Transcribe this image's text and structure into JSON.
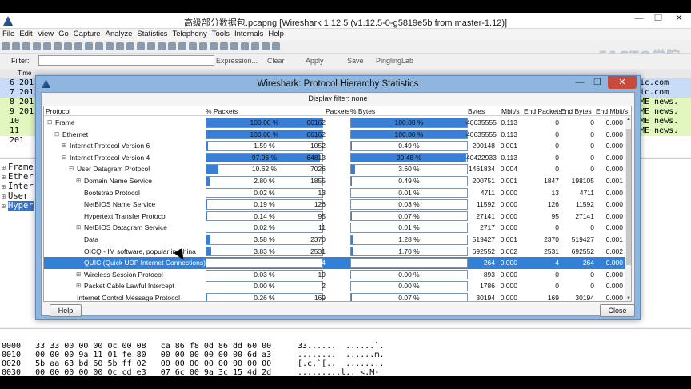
{
  "window": {
    "title": "高级部分数据包.pcapng   [Wireshark 1.12.5  (v1.12.5-0-g5819e5b from master-1.12)]",
    "minimize": "—",
    "maximize": "❐",
    "close": "✕"
  },
  "menu": [
    "File",
    "Edit",
    "View",
    "Go",
    "Capture",
    "Analyze",
    "Statistics",
    "Telephony",
    "Tools",
    "Internals",
    "Help"
  ],
  "filterbar": {
    "label": "Filter:",
    "value": "",
    "buttons": [
      "Expression...",
      "Clear",
      "Apply",
      "Save",
      "PinglingLab"
    ]
  },
  "watermark": "51CTO学院",
  "packet_list": {
    "header": "Time",
    "rows": [
      "6 201",
      "7 201",
      "8 201",
      "9 201",
      "10 201",
      "11 201"
    ],
    "right_rows": [
      "ic.com",
      "ic.com",
      "ME news.",
      "ME news.",
      "ME news.",
      "ME news."
    ]
  },
  "detail_tree": [
    {
      "label": "Frame",
      "selected": false
    },
    {
      "label": "Ether",
      "selected": false
    },
    {
      "label": "Inter",
      "selected": false
    },
    {
      "label": "User ",
      "selected": false
    },
    {
      "label": "Hyper",
      "selected": true
    }
  ],
  "hex_dump": [
    {
      "offset": "0000",
      "hex": "33 33 00 00 00 0c 00 08   ca 86 f8 0d 86 dd 60 00",
      "ascii": "33......  ......`."
    },
    {
      "offset": "0010",
      "hex": "00 00 00 9a 11 01 fe 80   00 00 00 00 00 00 6d a3",
      "ascii": "........  ......m."
    },
    {
      "offset": "0020",
      "hex": "5b aa 63 bd 60 5b ff 02   00 00 00 00 00 00 00 00",
      "ascii": "[.c.`[..  ........"
    },
    {
      "offset": "0030",
      "hex": "00 00 00 00 00 0c cd e3   07 6c 00 9a 3c 15 4d 2d",
      "ascii": ".........l.. <.M-"
    }
  ],
  "dialog": {
    "title": "Wireshark: Protocol Hierarchy Statistics",
    "display_filter": "Display filter: none",
    "columns": [
      "Protocol",
      "% Packets",
      "Packets",
      "% Bytes",
      "Bytes",
      "Mbit/s",
      "End Packets",
      "End Bytes",
      "End Mbit/s"
    ],
    "rows": [
      {
        "indent": 0,
        "toggle": "⊟",
        "protocol": "Frame",
        "pct_packets": 100.0,
        "pct_packets_label": "100.00 %",
        "packets": "66162",
        "pct_bytes": 100.0,
        "pct_bytes_label": "100.00 %",
        "bytes": "40635555",
        "mbit": "0.113",
        "end_packets": "0",
        "end_bytes": "0",
        "end_mbit": "0.000",
        "selected": false
      },
      {
        "indent": 1,
        "toggle": "⊟",
        "protocol": "Ethernet",
        "pct_packets": 100.0,
        "pct_packets_label": "100.00 %",
        "packets": "66162",
        "pct_bytes": 100.0,
        "pct_bytes_label": "100.00 %",
        "bytes": "40635555",
        "mbit": "0.113",
        "end_packets": "0",
        "end_bytes": "0",
        "end_mbit": "0.000",
        "selected": false
      },
      {
        "indent": 2,
        "toggle": "⊞",
        "protocol": "Internet Protocol Version 6",
        "pct_packets": 1.59,
        "pct_packets_label": "1.59 %",
        "packets": "1052",
        "pct_bytes": 0.49,
        "pct_bytes_label": "0.49 %",
        "bytes": "200148",
        "mbit": "0.001",
        "end_packets": "0",
        "end_bytes": "0",
        "end_mbit": "0.000",
        "selected": false
      },
      {
        "indent": 2,
        "toggle": "⊟",
        "protocol": "Internet Protocol Version 4",
        "pct_packets": 97.96,
        "pct_packets_label": "97.96 %",
        "packets": "64813",
        "pct_bytes": 99.48,
        "pct_bytes_label": "99.48 %",
        "bytes": "40422933",
        "mbit": "0.113",
        "end_packets": "0",
        "end_bytes": "0",
        "end_mbit": "0.000",
        "selected": false
      },
      {
        "indent": 3,
        "toggle": "⊟",
        "protocol": "User Datagram Protocol",
        "pct_packets": 10.62,
        "pct_packets_label": "10.62 %",
        "packets": "7026",
        "pct_bytes": 3.6,
        "pct_bytes_label": "3.60 %",
        "bytes": "1461834",
        "mbit": "0.004",
        "end_packets": "0",
        "end_bytes": "0",
        "end_mbit": "0.000",
        "selected": false
      },
      {
        "indent": 4,
        "toggle": "⊞",
        "protocol": "Domain Name Service",
        "pct_packets": 2.8,
        "pct_packets_label": "2.80 %",
        "packets": "1855",
        "pct_bytes": 0.49,
        "pct_bytes_label": "0.49 %",
        "bytes": "200751",
        "mbit": "0.001",
        "end_packets": "1847",
        "end_bytes": "198105",
        "end_mbit": "0.001",
        "selected": false
      },
      {
        "indent": 4,
        "toggle": "",
        "protocol": "Bootstrap Protocol",
        "pct_packets": 0.02,
        "pct_packets_label": "0.02 %",
        "packets": "13",
        "pct_bytes": 0.01,
        "pct_bytes_label": "0.01 %",
        "bytes": "4711",
        "mbit": "0.000",
        "end_packets": "13",
        "end_bytes": "4711",
        "end_mbit": "0.000",
        "selected": false
      },
      {
        "indent": 4,
        "toggle": "",
        "protocol": "NetBIOS Name Service",
        "pct_packets": 0.19,
        "pct_packets_label": "0.19 %",
        "packets": "126",
        "pct_bytes": 0.03,
        "pct_bytes_label": "0.03 %",
        "bytes": "11592",
        "mbit": "0.000",
        "end_packets": "126",
        "end_bytes": "11592",
        "end_mbit": "0.000",
        "selected": false
      },
      {
        "indent": 4,
        "toggle": "",
        "protocol": "Hypertext Transfer Protocol",
        "pct_packets": 0.14,
        "pct_packets_label": "0.14 %",
        "packets": "95",
        "pct_bytes": 0.07,
        "pct_bytes_label": "0.07 %",
        "bytes": "27141",
        "mbit": "0.000",
        "end_packets": "95",
        "end_bytes": "27141",
        "end_mbit": "0.000",
        "selected": false
      },
      {
        "indent": 4,
        "toggle": "⊞",
        "protocol": "NetBIOS Datagram Service",
        "pct_packets": 0.02,
        "pct_packets_label": "0.02 %",
        "packets": "11",
        "pct_bytes": 0.01,
        "pct_bytes_label": "0.01 %",
        "bytes": "2717",
        "mbit": "0.000",
        "end_packets": "0",
        "end_bytes": "0",
        "end_mbit": "0.000",
        "selected": false
      },
      {
        "indent": 4,
        "toggle": "",
        "protocol": "Data",
        "pct_packets": 3.58,
        "pct_packets_label": "3.58 %",
        "packets": "2370",
        "pct_bytes": 1.28,
        "pct_bytes_label": "1.28 %",
        "bytes": "519427",
        "mbit": "0.001",
        "end_packets": "2370",
        "end_bytes": "519427",
        "end_mbit": "0.001",
        "selected": false
      },
      {
        "indent": 4,
        "toggle": "",
        "protocol": "OICQ - IM software, popular in China",
        "pct_packets": 3.83,
        "pct_packets_label": "3.83 %",
        "packets": "2531",
        "pct_bytes": 1.7,
        "pct_bytes_label": "1.70 %",
        "bytes": "692552",
        "mbit": "0.002",
        "end_packets": "2531",
        "end_bytes": "692552",
        "end_mbit": "0.002",
        "selected": false
      },
      {
        "indent": 4,
        "toggle": "",
        "protocol": "QUIC (Quick UDP Internet Connections)",
        "pct_packets": 0.01,
        "pct_packets_label": "0.01 %",
        "packets": "4",
        "pct_bytes": 0.0,
        "pct_bytes_label": "0.00 %",
        "bytes": "264",
        "mbit": "0.000",
        "end_packets": "4",
        "end_bytes": "264",
        "end_mbit": "0.000",
        "selected": true
      },
      {
        "indent": 4,
        "toggle": "⊞",
        "protocol": "Wireless Session Protocol",
        "pct_packets": 0.03,
        "pct_packets_label": "0.03 %",
        "packets": "19",
        "pct_bytes": 0.0,
        "pct_bytes_label": "0.00 %",
        "bytes": "893",
        "mbit": "0.000",
        "end_packets": "0",
        "end_bytes": "0",
        "end_mbit": "0.000",
        "selected": false
      },
      {
        "indent": 4,
        "toggle": "⊞",
        "protocol": "Packet Cable Lawful Intercept",
        "pct_packets": 0.0,
        "pct_packets_label": "0.00 %",
        "packets": "2",
        "pct_bytes": 0.0,
        "pct_bytes_label": "0.00 %",
        "bytes": "1786",
        "mbit": "0.000",
        "end_packets": "0",
        "end_bytes": "0",
        "end_mbit": "0.000",
        "selected": false
      },
      {
        "indent": 3,
        "toggle": "",
        "protocol": "Internet Control Message Protocol",
        "pct_packets": 0.26,
        "pct_packets_label": "0.26 %",
        "packets": "169",
        "pct_bytes": 0.07,
        "pct_bytes_label": "0.07 %",
        "bytes": "30194",
        "mbit": "0.000",
        "end_packets": "169",
        "end_bytes": "30194",
        "end_mbit": "0.000",
        "selected": false
      }
    ],
    "help_button": "Help",
    "close_button": "Close"
  }
}
